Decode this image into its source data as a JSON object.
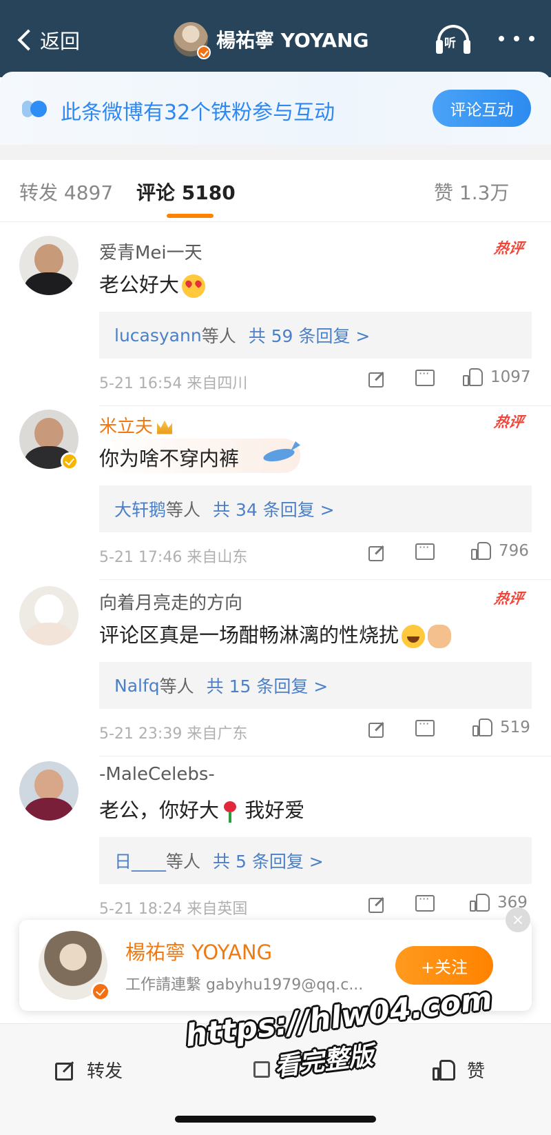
{
  "header": {
    "back_label": "返回",
    "title": "楊祐寧 YOYANG",
    "listen_label": "听"
  },
  "fan_banner": {
    "text": "此条微博有32个铁粉参与互动",
    "button": "评论互动"
  },
  "tabs": [
    {
      "label": "转发 4897"
    },
    {
      "label": "评论 5180",
      "active": true
    },
    {
      "label": "赞 1.3万"
    }
  ],
  "comments": [
    {
      "name": "爱青Mei一天",
      "hot": "热评",
      "text": "老公好大",
      "emoji": [
        "heart-eyes"
      ],
      "replies_user": "lucasyann",
      "replies_mid": "等人",
      "replies_count": "共 59 条回复 >",
      "meta": "5-21 16:54  来自四川",
      "likes": "1097"
    },
    {
      "name": "米立夫",
      "hot": "热评",
      "text": "你为啥不穿内裤",
      "replies_user": "大轩鹅",
      "replies_mid": "等人",
      "replies_count": "共 34 条回复 >",
      "meta": "5-21 17:46  来自山东",
      "likes": "796"
    },
    {
      "name": "向着月亮走的方向",
      "hot": "热评",
      "text": "评论区真是一场酣畅淋漓的性烧扰",
      "emoji": [
        "laugh",
        "ok"
      ],
      "replies_user": "Nalfq",
      "replies_mid": "等人",
      "replies_count": "共 15 条回复 >",
      "meta": "5-21 23:39  来自广东",
      "likes": "519"
    },
    {
      "name": "-MaleCelebs-",
      "text_a": "老公，你好大",
      "text_b": "我好爱",
      "emoji": [
        "rose"
      ],
      "replies_user": "日____",
      "replies_mid": "等人",
      "replies_count": "共 5 条回复 >",
      "meta": "5-21 18:24  来自英国",
      "likes": "369"
    }
  ],
  "follow_card": {
    "name": "楊祐寧 YOYANG",
    "desc": "工作請連繫 gabyhu1979@qq.c...",
    "button": "+关注",
    "close": "×"
  },
  "bottom_bar": {
    "share": "转发",
    "like": "赞"
  },
  "watermark": {
    "line1": "https://hlw04.com",
    "line2": "看完整版"
  },
  "colors": {
    "topbar": "#27445a",
    "accent_orange": "#ff8200",
    "link_blue": "#4b7fc7",
    "hot_red": "#f0463a"
  }
}
